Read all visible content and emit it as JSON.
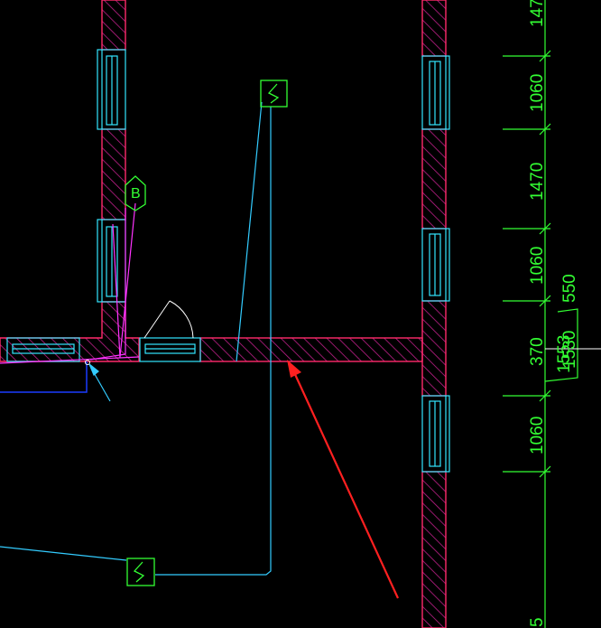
{
  "drawing": {
    "colors": {
      "background": "#000000",
      "wall_outline": "#ff2a6a",
      "wall_hatch": "#c0208a",
      "window_frame": "#33e6ff",
      "wire": "#33ccff",
      "dimension": "#33ff33",
      "symbol": "#33ff33",
      "annotation_arrow": "#ff2020",
      "blue_outline": "#1a3cff",
      "magenta_line": "#ff33ff"
    },
    "dimensions": {
      "top_partial": "147",
      "d1": "1060",
      "d2": "1470",
      "d3": "1060",
      "d4": "550",
      "d5_overlap": "370",
      "d5_overlap_b": "1553",
      "d5_overlap_c": "1530",
      "d6": "1060",
      "bottom_partial": "5"
    },
    "symbols": {
      "tag_b": "B",
      "switch_upper": "switch-symbol",
      "switch_lower": "switch-symbol"
    }
  }
}
